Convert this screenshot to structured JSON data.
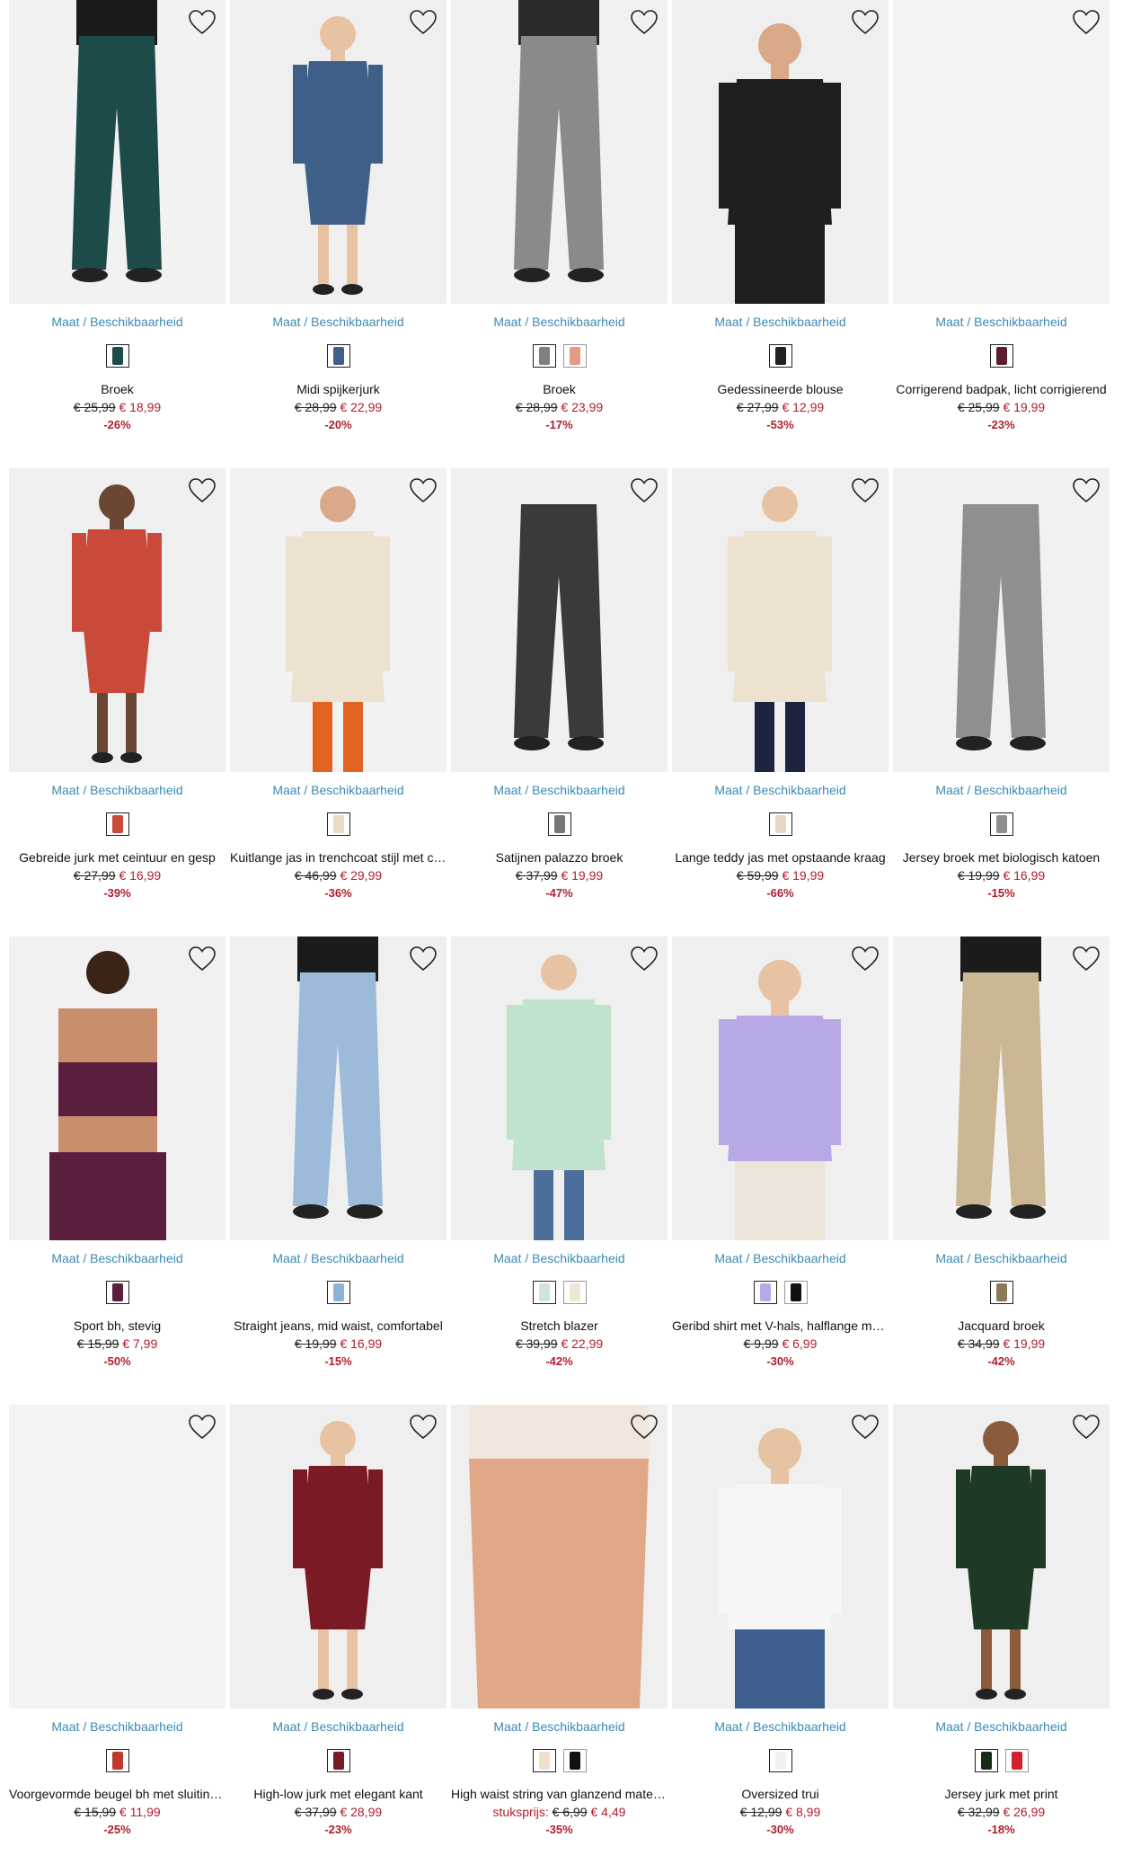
{
  "size_label": "Maat / Beschikbaarheid",
  "wishlist_icon": "heart-outline-icon",
  "colors": {
    "link": "#3a8bb5",
    "sale": "#b01e2e",
    "text": "#111111"
  },
  "products": [
    {
      "name": "Broek",
      "price_prefix": "",
      "old_price": "€ 25,99",
      "new_price": "€ 18,99",
      "discount": "-26%",
      "swatches": [
        "#1d4b4a"
      ],
      "photo": {
        "bg": "#f2f2f2",
        "top": "#1b1b1b",
        "bottom": "#1d4b4a",
        "skin": "#e9c4a8",
        "type": "pants"
      }
    },
    {
      "name": "Midi spijkerjurk",
      "price_prefix": "",
      "old_price": "€ 28,99",
      "new_price": "€ 22,99",
      "discount": "-20%",
      "swatches": [
        "#3e5f88"
      ],
      "photo": {
        "bg": "#efefef",
        "top": "#3e5f88",
        "bottom": "#3e5f88",
        "skin": "#e7c3a3",
        "type": "dress"
      }
    },
    {
      "name": "Broek",
      "price_prefix": "",
      "old_price": "€ 28,99",
      "new_price": "€ 23,99",
      "discount": "-17%",
      "swatches": [
        "#808080",
        "#e59a86"
      ],
      "photo": {
        "bg": "#f1f1f1",
        "top": "#2a2a2a",
        "bottom": "#8a8a8a",
        "skin": "#e7c3a3",
        "type": "pants"
      }
    },
    {
      "name": "Gedessineerde blouse",
      "price_prefix": "",
      "old_price": "€ 27,99",
      "new_price": "€ 12,99",
      "discount": "-53%",
      "swatches": [
        "#222222"
      ],
      "photo": {
        "bg": "#efefef",
        "top": "#1e1e1e",
        "bottom": "#1e1e1e",
        "skin": "#d9a98a",
        "type": "top"
      }
    },
    {
      "name": "Corrigerend badpak, licht corrigierend",
      "price_prefix": "",
      "old_price": "€ 25,99",
      "new_price": "€ 19,99",
      "discount": "-23%",
      "swatches": [
        "#5a1e2e"
      ],
      "photo": {
        "bg": "#f3f3f3",
        "top": "#f3f3f3",
        "bottom": "#f3f3f3",
        "skin": "#f3f3f3",
        "type": "empty"
      }
    },
    {
      "name": "Gebreide jurk met ceintuur en gesp",
      "price_prefix": "",
      "old_price": "€ 27,99",
      "new_price": "€ 16,99",
      "discount": "-39%",
      "swatches": [
        "#c94a3a"
      ],
      "photo": {
        "bg": "#efefef",
        "top": "#c94a3a",
        "bottom": "#c94a3a",
        "skin": "#6b4632",
        "type": "dress"
      }
    },
    {
      "name": "Kuitlange jas in trenchcoat stijl met ceintuur",
      "price_prefix": "",
      "old_price": "€ 46,99",
      "new_price": "€ 29,99",
      "discount": "-36%",
      "swatches": [
        "#e8dcc6"
      ],
      "photo": {
        "bg": "#f2f2f2",
        "top": "#ece2cf",
        "bottom": "#e2621f",
        "skin": "#d9a98a",
        "type": "coat"
      }
    },
    {
      "name": "Satijnen palazzo broek",
      "price_prefix": "",
      "old_price": "€ 37,99",
      "new_price": "€ 19,99",
      "discount": "-47%",
      "swatches": [
        "#777777"
      ],
      "photo": {
        "bg": "#f0f0f0",
        "top": "#f0f0f0",
        "bottom": "#3a3a3a",
        "skin": "#e7c3a3",
        "type": "pants"
      }
    },
    {
      "name": "Lange teddy jas met opstaande kraag",
      "price_prefix": "",
      "old_price": "€ 59,99",
      "new_price": "€ 19,99",
      "discount": "-66%",
      "swatches": [
        "#e6d8c4"
      ],
      "photo": {
        "bg": "#efefef",
        "top": "#ede1d0",
        "bottom": "#1d2440",
        "skin": "#e7c3a3",
        "type": "coat"
      }
    },
    {
      "name": "Jersey broek met biologisch katoen",
      "price_prefix": "",
      "old_price": "€ 19,99",
      "new_price": "€ 16,99",
      "discount": "-15%",
      "swatches": [
        "#8f8f8f"
      ],
      "photo": {
        "bg": "#f1f1f1",
        "top": "#f1f1f1",
        "bottom": "#8f8f8f",
        "skin": "#e7c3a3",
        "type": "pants"
      }
    },
    {
      "name": "Sport bh, stevig",
      "price_prefix": "",
      "old_price": "€ 15,99",
      "new_price": "€ 7,99",
      "discount": "-50%",
      "swatches": [
        "#5a1f3f"
      ],
      "photo": {
        "bg": "#f1f1f1",
        "top": "#5a1f3f",
        "bottom": "#5a1f3f",
        "skin": "#c98f6c",
        "type": "sport"
      }
    },
    {
      "name": "Straight jeans, mid waist, comfortabel",
      "price_prefix": "",
      "old_price": "€ 19,99",
      "new_price": "€ 16,99",
      "discount": "-15%",
      "swatches": [
        "#8fb3d6"
      ],
      "photo": {
        "bg": "#efefef",
        "top": "#1b1b1b",
        "bottom": "#9cbbdb",
        "skin": "#e7c3a3",
        "type": "pants"
      }
    },
    {
      "name": "Stretch blazer",
      "price_prefix": "",
      "old_price": "€ 39,99",
      "new_price": "€ 22,99",
      "discount": "-42%",
      "swatches": [
        "#cfe6d8",
        "#efe6d5"
      ],
      "photo": {
        "bg": "#efefef",
        "top": "#bfe3cc",
        "bottom": "#4b6f9a",
        "skin": "#e7c3a3",
        "type": "coat"
      }
    },
    {
      "name": "Geribd shirt met V-hals, halflange mouw",
      "price_prefix": "",
      "old_price": "€ 9,99",
      "new_price": "€ 6,99",
      "discount": "-30%",
      "swatches": [
        "#b8a9e6",
        "#111111"
      ],
      "photo": {
        "bg": "#efefef",
        "top": "#b8a9e6",
        "bottom": "#ece6da",
        "skin": "#e7c3a3",
        "type": "top"
      }
    },
    {
      "name": "Jacquard broek",
      "price_prefix": "",
      "old_price": "€ 34,99",
      "new_price": "€ 19,99",
      "discount": "-42%",
      "swatches": [
        "#8a7a5a"
      ],
      "photo": {
        "bg": "#f2f2f2",
        "top": "#1b1b1b",
        "bottom": "#cbb793",
        "skin": "#e7c3a3",
        "type": "pants"
      }
    },
    {
      "name": "Voorgevormde beugel bh met sluiting voor",
      "price_prefix": "",
      "old_price": "€ 15,99",
      "new_price": "€ 11,99",
      "discount": "-25%",
      "swatches": [
        "#c0392b"
      ],
      "photo": {
        "bg": "#f3f3f3",
        "top": "#f3f3f3",
        "bottom": "#f3f3f3",
        "skin": "#f3f3f3",
        "type": "empty"
      }
    },
    {
      "name": "High-low jurk met elegant kant",
      "price_prefix": "",
      "old_price": "€ 37,99",
      "new_price": "€ 28,99",
      "discount": "-23%",
      "swatches": [
        "#7a1a24"
      ],
      "photo": {
        "bg": "#efefef",
        "top": "#7a1a24",
        "bottom": "#7a1a24",
        "skin": "#e7c3a3",
        "type": "dress"
      }
    },
    {
      "name": "High waist string van glanzend materiaal",
      "price_prefix": "stuksprijs: ",
      "old_price": "€ 6,99",
      "new_price": "€ 4,49",
      "discount": "-35%",
      "swatches": [
        "#efe0cf",
        "#111111"
      ],
      "photo": {
        "bg": "#efefef",
        "top": "#f1e7dc",
        "bottom": "#e0a887",
        "skin": "#e0a887",
        "type": "body"
      }
    },
    {
      "name": "Oversized trui",
      "price_prefix": "",
      "old_price": "€ 12,99",
      "new_price": "€ 8,99",
      "discount": "-30%",
      "swatches": [
        "#f0f0f0"
      ],
      "photo": {
        "bg": "#efefef",
        "top": "#f6f6f6",
        "bottom": "#3f5f8f",
        "skin": "#e7c3a3",
        "type": "top"
      }
    },
    {
      "name": "Jersey jurk met print",
      "price_prefix": "",
      "old_price": "€ 32,99",
      "new_price": "€ 26,99",
      "discount": "-18%",
      "swatches": [
        "#1a2a1a",
        "#d1212a"
      ],
      "photo": {
        "bg": "#efefef",
        "top": "#1f3a24",
        "bottom": "#1f3a24",
        "skin": "#8b5b3e",
        "type": "dress"
      }
    }
  ]
}
